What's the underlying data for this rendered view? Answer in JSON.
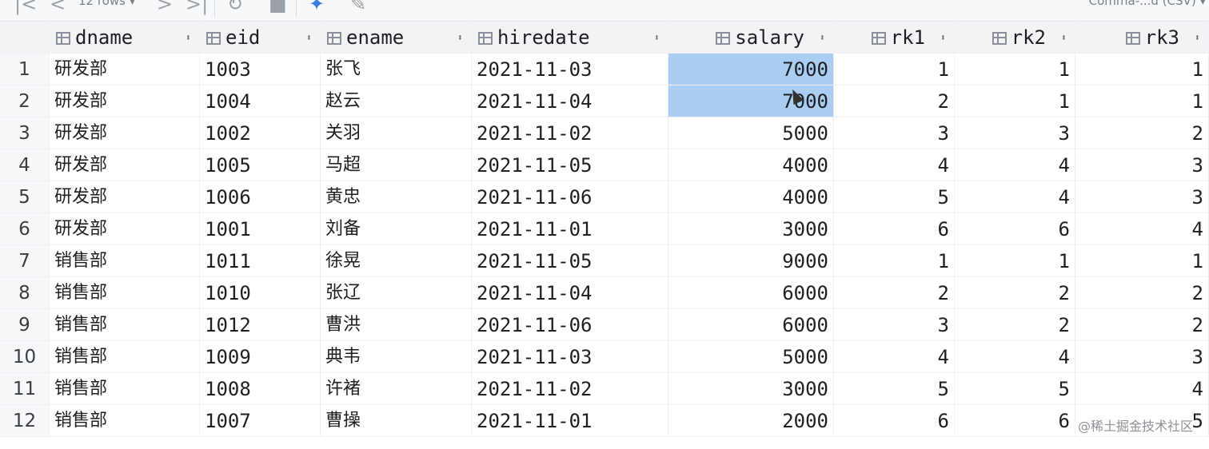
{
  "toolbar": {
    "rows_label": "12 rows",
    "format_label": "Comma-...d (CSV)"
  },
  "table": {
    "columns": [
      "dname",
      "eid",
      "ename",
      "hiredate",
      "salary",
      "rk1",
      "rk2",
      "rk3"
    ],
    "rows": [
      [
        "研发部",
        "1003",
        "张飞",
        "2021-11-03",
        "7000",
        "1",
        "1",
        "1"
      ],
      [
        "研发部",
        "1004",
        "赵云",
        "2021-11-04",
        "7000",
        "2",
        "1",
        "1"
      ],
      [
        "研发部",
        "1002",
        "关羽",
        "2021-11-02",
        "5000",
        "3",
        "3",
        "2"
      ],
      [
        "研发部",
        "1005",
        "马超",
        "2021-11-05",
        "4000",
        "4",
        "4",
        "3"
      ],
      [
        "研发部",
        "1006",
        "黄忠",
        "2021-11-06",
        "4000",
        "5",
        "4",
        "3"
      ],
      [
        "研发部",
        "1001",
        "刘备",
        "2021-11-01",
        "3000",
        "6",
        "6",
        "4"
      ],
      [
        "销售部",
        "1011",
        "徐晃",
        "2021-11-05",
        "9000",
        "1",
        "1",
        "1"
      ],
      [
        "销售部",
        "1010",
        "张辽",
        "2021-11-04",
        "6000",
        "2",
        "2",
        "2"
      ],
      [
        "销售部",
        "1012",
        "曹洪",
        "2021-11-06",
        "6000",
        "3",
        "2",
        "2"
      ],
      [
        "销售部",
        "1009",
        "典韦",
        "2021-11-03",
        "5000",
        "4",
        "4",
        "3"
      ],
      [
        "销售部",
        "1008",
        "许褚",
        "2021-11-02",
        "3000",
        "5",
        "5",
        "4"
      ],
      [
        "销售部",
        "1007",
        "曹操",
        "2021-11-01",
        "2000",
        "6",
        "6",
        "5"
      ]
    ],
    "selected_cells": [
      [
        0,
        4
      ],
      [
        1,
        4
      ]
    ]
  },
  "watermark": "@稀土掘金技术社区",
  "colors": {
    "selection": "#a9cdf3",
    "header_bg": "#f2f3f5"
  }
}
